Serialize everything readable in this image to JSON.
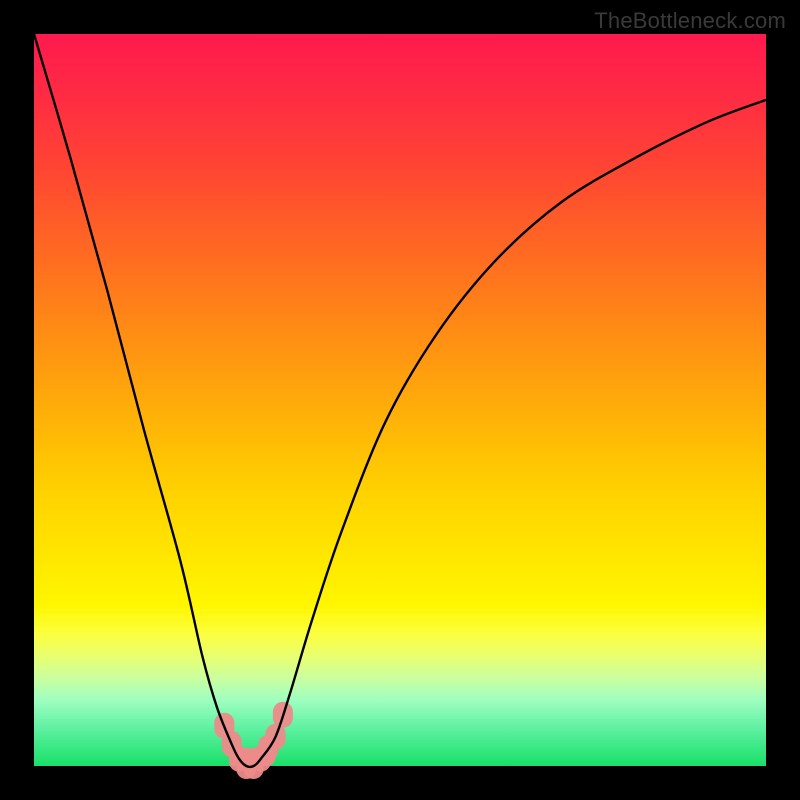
{
  "watermark": "TheBottleneck.com",
  "chart_data": {
    "type": "line",
    "title": "",
    "xlabel": "",
    "ylabel": "",
    "xlim": [
      0,
      100
    ],
    "ylim": [
      0,
      100
    ],
    "series": [
      {
        "name": "bottleneck-curve",
        "x": [
          0,
          5,
          10,
          15,
          20,
          23,
          25,
          27,
          28,
          29,
          30,
          31,
          33,
          35,
          38,
          42,
          48,
          55,
          63,
          72,
          82,
          92,
          100
        ],
        "values": [
          100,
          83,
          65,
          46,
          28,
          15,
          8,
          3,
          1,
          0,
          0,
          1,
          4,
          10,
          20,
          32,
          47,
          59,
          69,
          77,
          83,
          88,
          91
        ]
      }
    ],
    "sweet_spot_range": {
      "x_start": 26,
      "x_end": 34
    },
    "gradient_stops": [
      {
        "pos": 0,
        "color": "#ff1a4d"
      },
      {
        "pos": 50,
        "color": "#ffd000"
      },
      {
        "pos": 80,
        "color": "#fcff40"
      },
      {
        "pos": 100,
        "color": "#18e068"
      }
    ]
  }
}
